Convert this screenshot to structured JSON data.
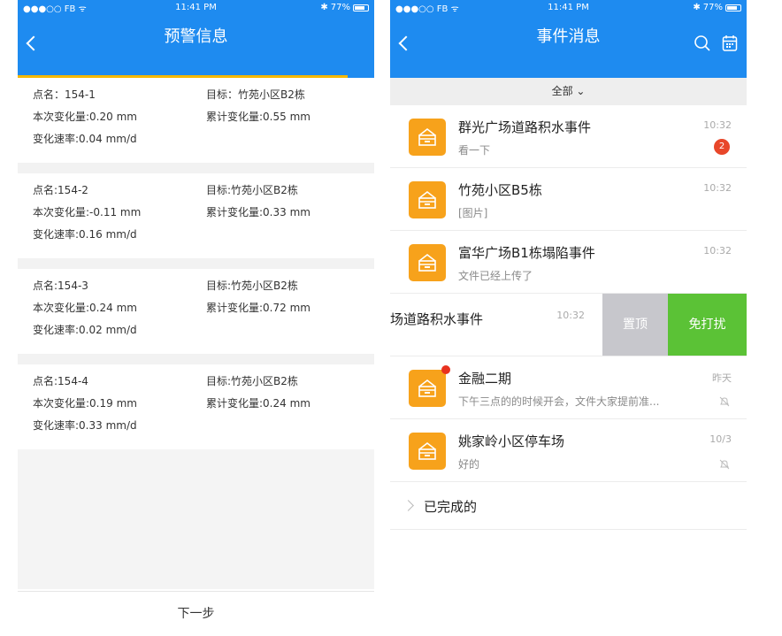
{
  "status_bar": {
    "carrier": "●●●○○ FB ᯤ",
    "time": "11:41 PM",
    "battery": "77%"
  },
  "warning_screen": {
    "title": "预警信息",
    "cards": [
      {
        "point": "点名：154-1",
        "target": "目标：竹苑小区B2栋",
        "change": "本次变化量:0.20 mm",
        "total": "累计变化量:0.55 mm",
        "rate": "变化速率:0.04 mm/d"
      },
      {
        "point": "点名:154-2",
        "target": "目标:竹苑小区B2栋",
        "change": "本次变化量:-0.11 mm",
        "total": "累计变化量:0.33 mm",
        "rate": "变化速率:0.16 mm/d"
      },
      {
        "point": "点名:154-3",
        "target": "目标:竹苑小区B2栋",
        "change": "本次变化量:0.24 mm",
        "total": "累计变化量:0.72 mm",
        "rate": "变化速率:0.02 mm/d"
      },
      {
        "point": "点名:154-4",
        "target": "目标:竹苑小区B2栋",
        "change": "本次变化量:0.19 mm",
        "total": "累计变化量:0.24 mm",
        "rate": "变化速率:0.33 mm/d"
      }
    ],
    "next_button": "下一步"
  },
  "events_screen": {
    "title": "事件消息",
    "filter": "全部 ⌄",
    "messages": [
      {
        "title": "群光广场道路积水事件",
        "subtitle": "看一下",
        "time": "10:32",
        "badge": "2"
      },
      {
        "title": "竹苑小区B5栋",
        "subtitle": "[图片]",
        "time": "10:32"
      },
      {
        "title": "富华广场B1栋塌陷事件",
        "subtitle": "文件已经上传了",
        "time": "10:32"
      }
    ],
    "swiped": {
      "title": "场道路积水事件",
      "time": "10:32",
      "pin_label": "置顶",
      "dnd_label": "免打扰"
    },
    "messages_after": [
      {
        "title": "金融二期",
        "subtitle": "下午三点的的时候开会，文件大家提前准...",
        "time": "昨天"
      },
      {
        "title": "姚家岭小区停车场",
        "subtitle": "好的",
        "time": "10/3"
      }
    ],
    "completed_label": "已完成的"
  },
  "colors": {
    "nav_blue": "#1e8bf0",
    "accent_yellow": "#f6b800",
    "icon_orange": "#f7a21b",
    "dnd_green": "#5bc236",
    "badge_red": "#e8472a"
  }
}
